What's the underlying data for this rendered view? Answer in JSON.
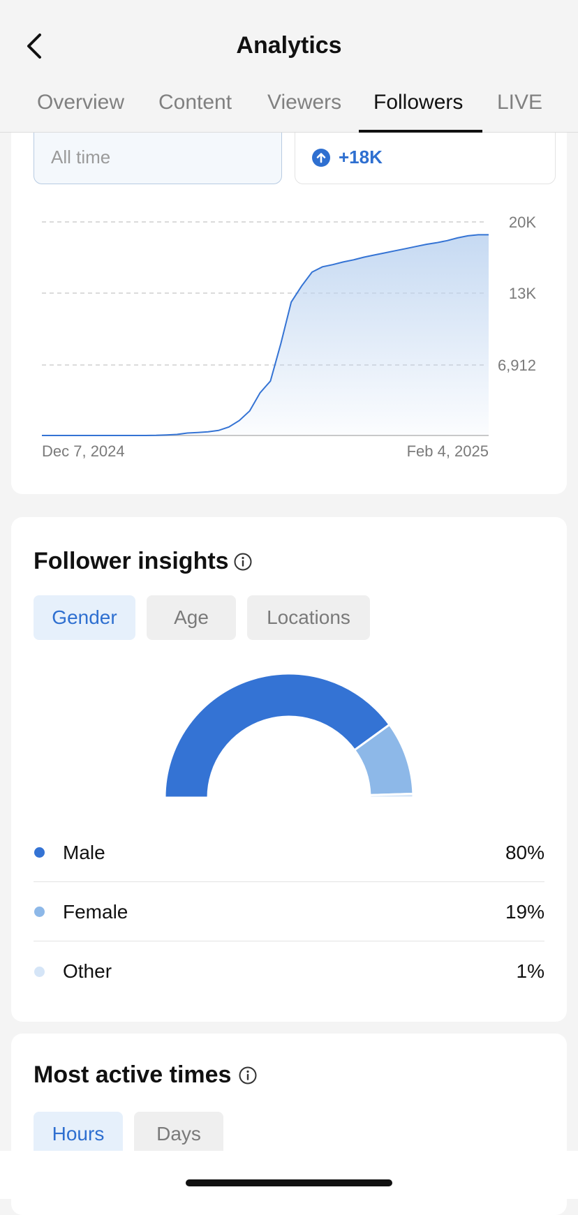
{
  "header": {
    "title": "Analytics",
    "tabs": [
      {
        "label": "Overview",
        "active": false
      },
      {
        "label": "Content",
        "active": false
      },
      {
        "label": "Viewers",
        "active": false
      },
      {
        "label": "Followers",
        "active": true
      },
      {
        "label": "LIVE",
        "active": false
      }
    ]
  },
  "summary": {
    "period_value": "All time",
    "growth_value": "+18K"
  },
  "colors": {
    "accent": "#2e6fd0",
    "male": "#3473d4",
    "female": "#8db8e8",
    "other": "#d5e5f7"
  },
  "chart_data": {
    "type": "area",
    "x": [
      "Dec 7, 2024",
      "Feb 4, 2025"
    ],
    "xlabel": "",
    "ylabel": "",
    "y_ticks": [
      "20K",
      "13K",
      "6,912"
    ],
    "ylim": [
      0,
      20000
    ],
    "grid": true,
    "points": [
      0,
      0,
      0,
      0,
      0,
      0,
      0,
      0,
      0,
      0,
      0,
      10,
      50,
      100,
      230,
      280,
      340,
      470,
      800,
      1400,
      2300,
      4000,
      5100,
      8600,
      12500,
      14000,
      15300,
      15800,
      16000,
      16250,
      16450,
      16700,
      16900,
      17100,
      17300,
      17500,
      17700,
      17900,
      18050,
      18250,
      18500,
      18700,
      18800,
      18800
    ]
  },
  "insights": {
    "title": "Follower insights",
    "tabs": [
      {
        "label": "Gender",
        "active": true
      },
      {
        "label": "Age",
        "active": false
      },
      {
        "label": "Locations",
        "active": false
      }
    ],
    "gender": [
      {
        "label": "Male",
        "value": "80%",
        "pct": 80
      },
      {
        "label": "Female",
        "value": "19%",
        "pct": 19
      },
      {
        "label": "Other",
        "value": "1%",
        "pct": 1
      }
    ]
  },
  "active_times": {
    "title": "Most active times",
    "tabs": [
      {
        "label": "Hours",
        "active": true
      },
      {
        "label": "Days",
        "active": false
      }
    ]
  }
}
